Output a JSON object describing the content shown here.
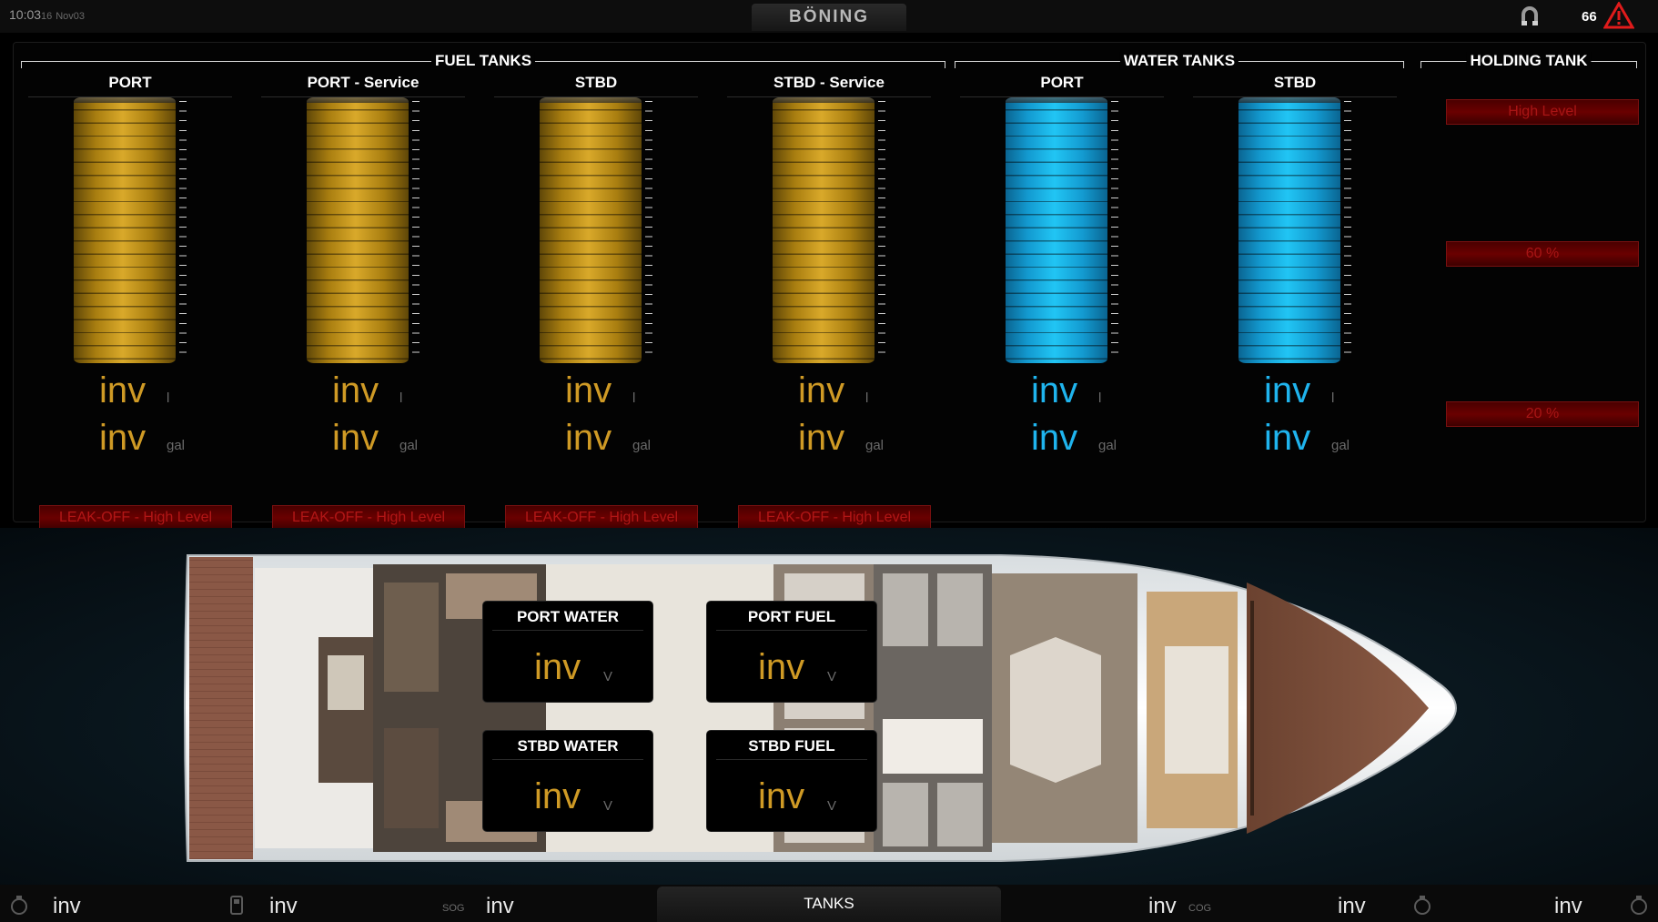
{
  "topbar": {
    "time": "10:03",
    "seconds": "16",
    "date": "Nov03",
    "brand": "BÖNING",
    "alarm_count": "66"
  },
  "groups": {
    "fuel": "FUEL TANKS",
    "water": "WATER TANKS",
    "holding": "HOLDING TANK"
  },
  "tanks": [
    {
      "name": "PORT",
      "value1": "inv",
      "unit1": "l",
      "value2": "inv",
      "unit2": "gal",
      "alarm": "LEAK-OFF - High Level",
      "kind": "fuel"
    },
    {
      "name": "PORT - Service",
      "value1": "inv",
      "unit1": "l",
      "value2": "inv",
      "unit2": "gal",
      "alarm": "LEAK-OFF - High Level",
      "kind": "fuel"
    },
    {
      "name": "STBD",
      "value1": "inv",
      "unit1": "l",
      "value2": "inv",
      "unit2": "gal",
      "alarm": "LEAK-OFF - High Level",
      "kind": "fuel"
    },
    {
      "name": "STBD - Service",
      "value1": "inv",
      "unit1": "l",
      "value2": "inv",
      "unit2": "gal",
      "alarm": "LEAK-OFF - High Level",
      "kind": "fuel"
    },
    {
      "name": "PORT",
      "value1": "inv",
      "unit1": "l",
      "value2": "inv",
      "unit2": "gal",
      "kind": "water"
    },
    {
      "name": "STBD",
      "value1": "inv",
      "unit1": "l",
      "value2": "inv",
      "unit2": "gal",
      "kind": "water"
    }
  ],
  "holding": {
    "high_level": "High Level",
    "level_60": "60 %",
    "level_20": "20 %"
  },
  "colors": {
    "fuel": "#cf9a25",
    "water": "#1fb4ee",
    "alarm": "#b21616"
  },
  "readouts": [
    {
      "title": "PORT WATER",
      "value": "inv",
      "unit": "V"
    },
    {
      "title": "PORT FUEL",
      "value": "inv",
      "unit": "V"
    },
    {
      "title": "STBD WATER",
      "value": "inv",
      "unit": "V"
    },
    {
      "title": "STBD FUEL",
      "value": "inv",
      "unit": "V"
    }
  ],
  "bottombar": {
    "item1": "inv",
    "item2": "inv",
    "sog_label": "SOG",
    "sog_value": "inv",
    "tab": "TANKS",
    "cog_value": "inv",
    "cog_label": "COG",
    "item6": "inv",
    "item7": "inv",
    "icons": [
      "engine-icon",
      "fuel-pump-icon",
      "engine-icon",
      "engine-icon"
    ]
  }
}
